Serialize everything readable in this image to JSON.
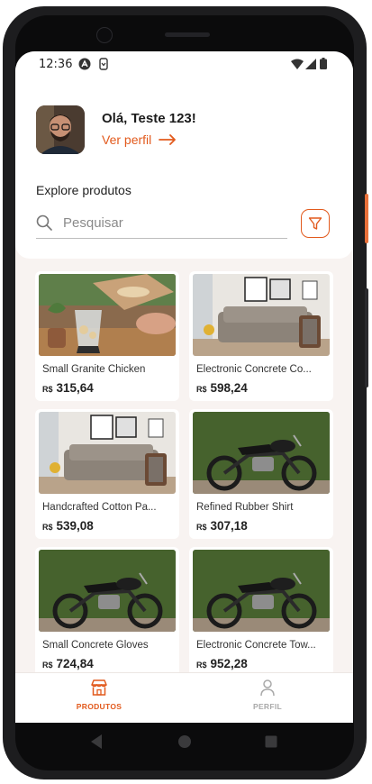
{
  "status_bar": {
    "time": "12:36"
  },
  "header": {
    "greeting": "Olá, Teste 123!",
    "profile_link": "Ver perfil",
    "explore_label": "Explore produtos",
    "search_placeholder": "Pesquisar"
  },
  "products": [
    {
      "name": "Small Granite Chicken",
      "currency": "R$",
      "price": "315,64",
      "image": "food-processor"
    },
    {
      "name": "Electronic Concrete Co...",
      "currency": "R$",
      "price": "598,24",
      "image": "sofa"
    },
    {
      "name": "Handcrafted Cotton Pa...",
      "currency": "R$",
      "price": "539,08",
      "image": "sofa"
    },
    {
      "name": "Refined Rubber Shirt",
      "currency": "R$",
      "price": "307,18",
      "image": "motorcycle"
    },
    {
      "name": "Small Concrete Gloves",
      "currency": "R$",
      "price": "724,84",
      "image": "motorcycle"
    },
    {
      "name": "Electronic Concrete Tow...",
      "currency": "R$",
      "price": "952,28",
      "image": "motorcycle"
    }
  ],
  "bottom_nav": {
    "products_label": "PRODUTOS",
    "profile_label": "PERFIL"
  },
  "colors": {
    "accent": "#e25a1d",
    "background": "#f8f3f1",
    "inactive": "#a9a9a9"
  }
}
